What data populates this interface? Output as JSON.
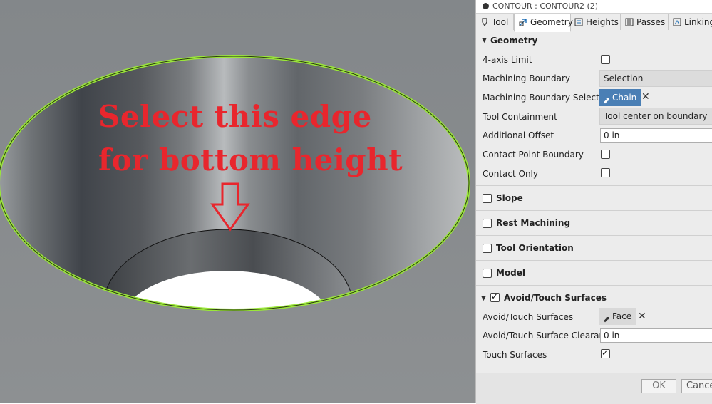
{
  "annotation": {
    "line1": "Select this edge",
    "line2": "for bottom height"
  },
  "panel": {
    "title": "CONTOUR : CONTOUR2 (2)",
    "tabs": [
      {
        "label": "Tool",
        "icon": "tool-icon"
      },
      {
        "label": "Geometry",
        "icon": "geometry-icon",
        "active": true
      },
      {
        "label": "Heights",
        "icon": "heights-icon"
      },
      {
        "label": "Passes",
        "icon": "passes-icon"
      },
      {
        "label": "Linking",
        "icon": "linking-icon"
      }
    ],
    "geometry": {
      "header": "Geometry",
      "four_axis_label": "4-axis Limit",
      "four_axis_checked": false,
      "boundary_label": "Machining Boundary",
      "boundary_value": "Selection",
      "boundary_selection_label": "Machining Boundary Selection",
      "chain_label": "Chain",
      "containment_label": "Tool Containment",
      "containment_value": "Tool center on boundary",
      "offset_label": "Additional Offset",
      "offset_value": "0 in",
      "contact_boundary_label": "Contact Point Boundary",
      "contact_boundary_checked": false,
      "contact_only_label": "Contact Only",
      "contact_only_checked": false
    },
    "groups": {
      "slope": "Slope",
      "rest": "Rest Machining",
      "orientation": "Tool Orientation",
      "model": "Model"
    },
    "avoid": {
      "header": "Avoid/Touch Surfaces",
      "header_checked": true,
      "surfaces_label": "Avoid/Touch Surfaces",
      "face_label": "Face",
      "clearance_label": "Avoid/Touch Surface Clearance",
      "clearance_value": "0 in",
      "touch_label": "Touch Surfaces",
      "touch_checked": true
    },
    "ok_label": "OK",
    "cancel_label": "Cancel"
  },
  "colors": {
    "annotation": "#e8262d",
    "edge_highlight": "#9ae63a",
    "chain_button": "#4a7fb5"
  }
}
